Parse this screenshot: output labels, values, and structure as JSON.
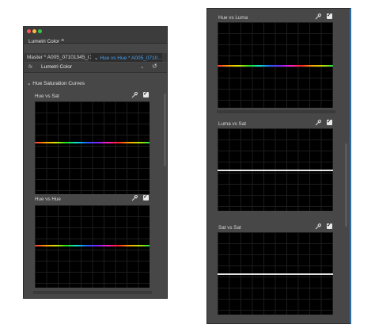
{
  "window": {
    "title": "Lumetri Color",
    "menu_icon": "menu-icon",
    "traffic_lights": [
      "#fc5753",
      "#fdbc40",
      "#33c748"
    ]
  },
  "tabs": {
    "master": "Master * A005_07101345_C...",
    "clip": "Hue vs Hue * A005_0710..."
  },
  "effect": {
    "fx": "fx",
    "name": "Lumetri Color"
  },
  "section": {
    "title": "Hue Saturation Curves"
  },
  "curves_left": [
    {
      "label": "Hue vs Sat"
    },
    {
      "label": "Hue vs Hue"
    }
  ],
  "curves_right": [
    {
      "label": "Hue vs Luma"
    },
    {
      "label": "Luma vs Sat"
    },
    {
      "label": "Sat vs Sat"
    }
  ],
  "colors": {
    "panel": "#474747",
    "accent": "#4aa0f0",
    "curve_bg": "#000000"
  }
}
